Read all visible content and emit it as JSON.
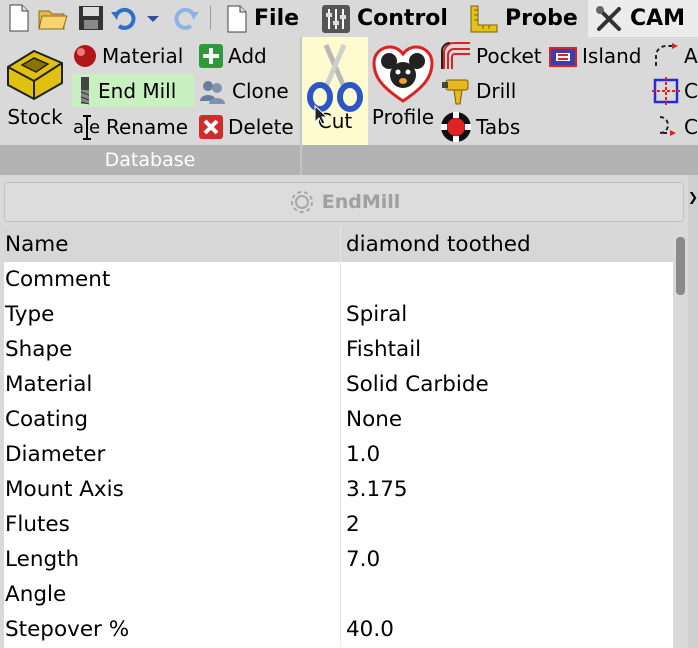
{
  "tabs": [
    {
      "label": "File",
      "icon": "file-icon",
      "active": false
    },
    {
      "label": "Control",
      "icon": "control-icon",
      "active": false
    },
    {
      "label": "Probe",
      "icon": "probe-icon",
      "active": false
    },
    {
      "label": "CAM",
      "icon": "cam-icon",
      "active": true
    }
  ],
  "ribbon": {
    "database_group": {
      "label": "Database",
      "stock_label": "Stock",
      "material_label": "Material",
      "endmill_label": "End Mill",
      "rename_label": "Rename",
      "add_label": "Add",
      "clone_label": "Clone",
      "delete_label": "Delete"
    },
    "cam_group": {
      "cut_label": "Cut",
      "profile_label": "Profile",
      "pocket_label": "Pocket",
      "drill_label": "Drill",
      "tabs_label": "Tabs",
      "island_label": "Island",
      "cut_off_labels": [
        "A",
        "C",
        "C"
      ]
    }
  },
  "panel": {
    "title": "EndMill",
    "rows": [
      {
        "key": "Name",
        "value": "diamond  toothed"
      },
      {
        "key": "Comment",
        "value": ""
      },
      {
        "key": "Type",
        "value": "Spiral"
      },
      {
        "key": "Shape",
        "value": "Fishtail"
      },
      {
        "key": "Material",
        "value": "Solid Carbide"
      },
      {
        "key": "Coating",
        "value": "None"
      },
      {
        "key": "Diameter",
        "value": "1.0"
      },
      {
        "key": "Mount Axis",
        "value": "3.175"
      },
      {
        "key": "Flutes",
        "value": "2"
      },
      {
        "key": "Length",
        "value": "7.0"
      },
      {
        "key": "Angle",
        "value": ""
      },
      {
        "key": "Stepover %",
        "value": "40.0"
      }
    ]
  },
  "colors": {
    "highlight_green": "#c9f0c0",
    "highlight_yellow": "#fffbd0",
    "group_footer": "#b3b3b3"
  }
}
